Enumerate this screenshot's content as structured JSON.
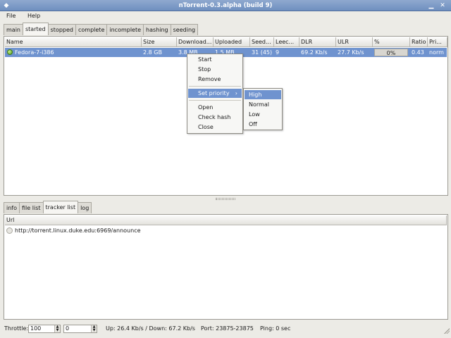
{
  "window": {
    "title": "nTorrent-0.3.alpha (build 9)"
  },
  "menubar": {
    "file": "File",
    "help": "Help"
  },
  "top_tabs": [
    "main",
    "started",
    "stopped",
    "complete",
    "incomplete",
    "hashing",
    "seeding"
  ],
  "torrent_table": {
    "columns": [
      "Name",
      "Size",
      "Download...",
      "Uploaded",
      "Seed...",
      "Leec...",
      "DLR",
      "ULR",
      "%",
      "Ratio",
      "Pri..."
    ],
    "rows": [
      {
        "name": "Fedora-7-i386",
        "size": "2.8 GB",
        "downloaded": "3.8 MB",
        "uploaded": "1.5 MB",
        "seeders": "31 (45)",
        "leechers": "9",
        "dlr": "69.2 Kb/s",
        "ulr": "27.7 Kb/s",
        "percent": "0%",
        "ratio": "0.43",
        "priority": "norm"
      }
    ]
  },
  "context_menu": {
    "items": [
      "Start",
      "Stop",
      "Remove",
      "Set priority",
      "Open",
      "Check hash",
      "Close"
    ],
    "submenu": [
      "High",
      "Normal",
      "Low",
      "Off"
    ]
  },
  "bottom_tabs": [
    "info",
    "file list",
    "tracker list",
    "log"
  ],
  "tracker_table": {
    "column": "Url",
    "rows": [
      "http://torrent.linux.duke.edu:6969/announce"
    ]
  },
  "statusbar": {
    "throttle_label": "Throttle:",
    "throttle_up": "100",
    "throttle_down": "0",
    "rates": "Up: 26.4 Kb/s / Down: 67.2 Kb/s",
    "port": "Port: 23875-23875",
    "ping": "Ping: 0 sec"
  },
  "colors": {
    "selection": "#6f93cf",
    "titlebar": "#7a97c4",
    "status_ok": "#4f9a1f"
  }
}
